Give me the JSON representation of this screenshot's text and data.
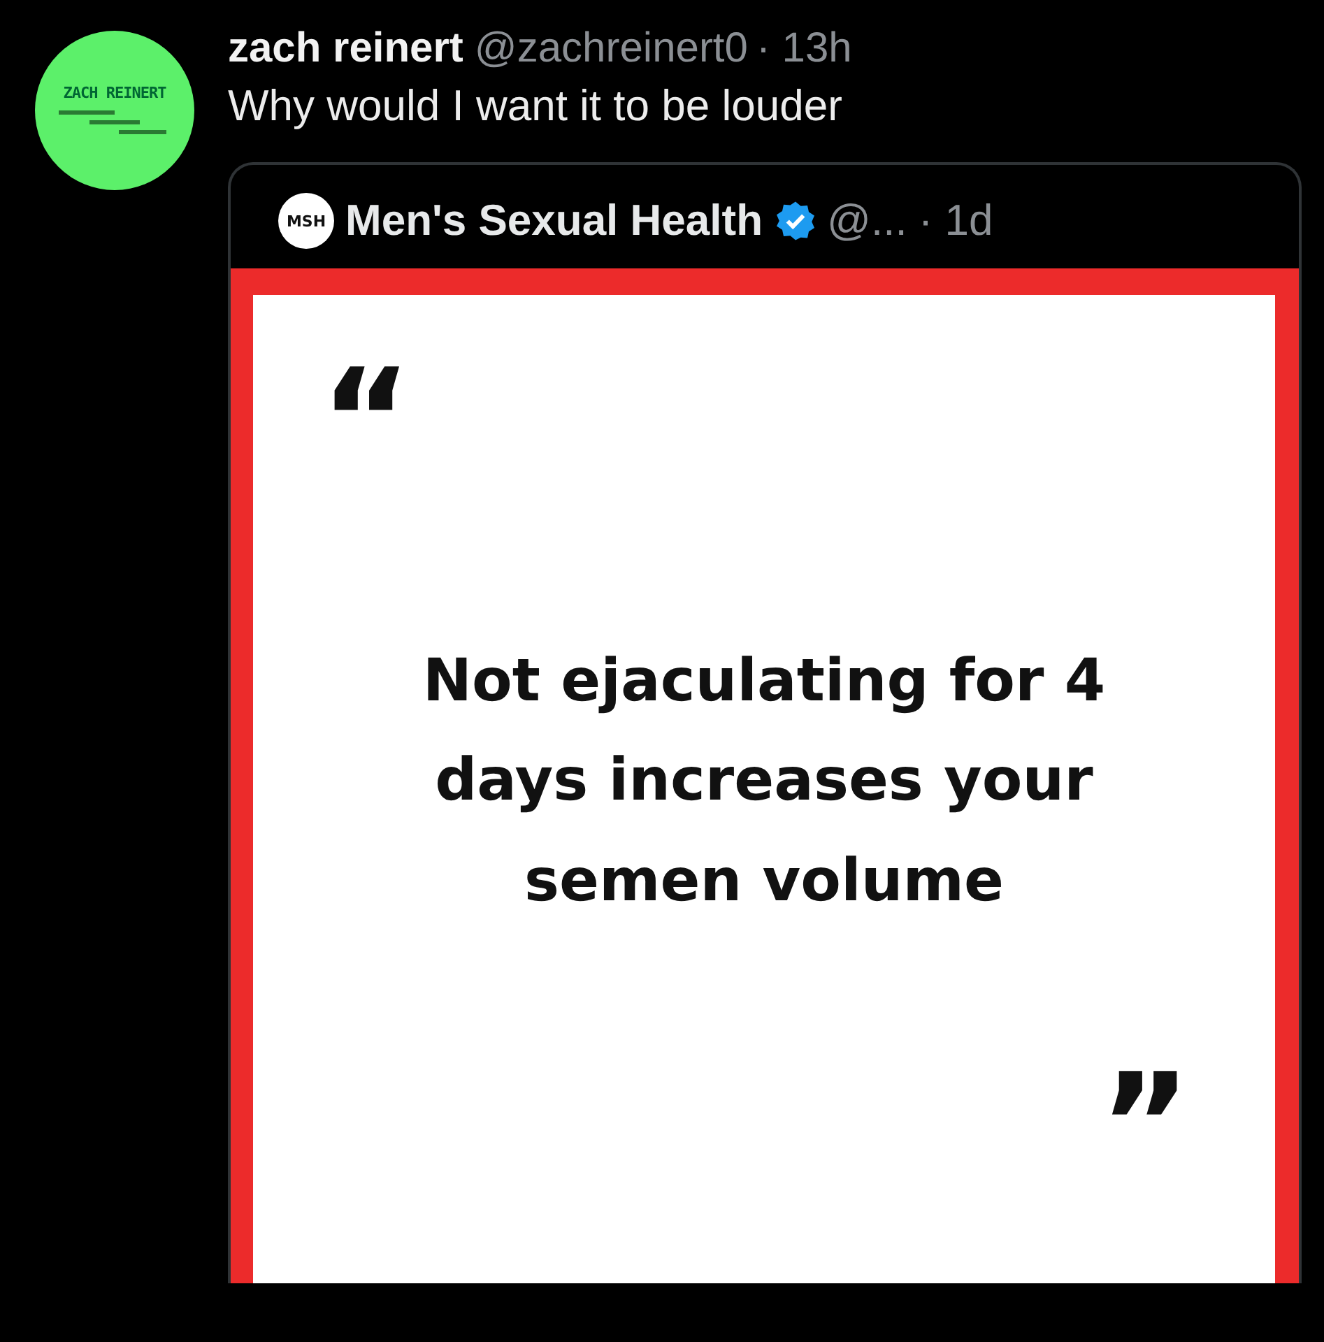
{
  "post": {
    "avatar_text": "ZACH REINERT",
    "author": "zach reinert",
    "handle": "@zachreinert0",
    "time": "· 13h",
    "text": "Why would I want it to be louder"
  },
  "quoted_post": {
    "logo_text": "MSH",
    "author": "Men's Sexual Health",
    "verified": true,
    "handle": "@...",
    "time": "· 1d",
    "image": {
      "open_quote": "“",
      "statement": "Not ejaculating for 4 days increases your semen volume",
      "close_quote": "”"
    }
  }
}
